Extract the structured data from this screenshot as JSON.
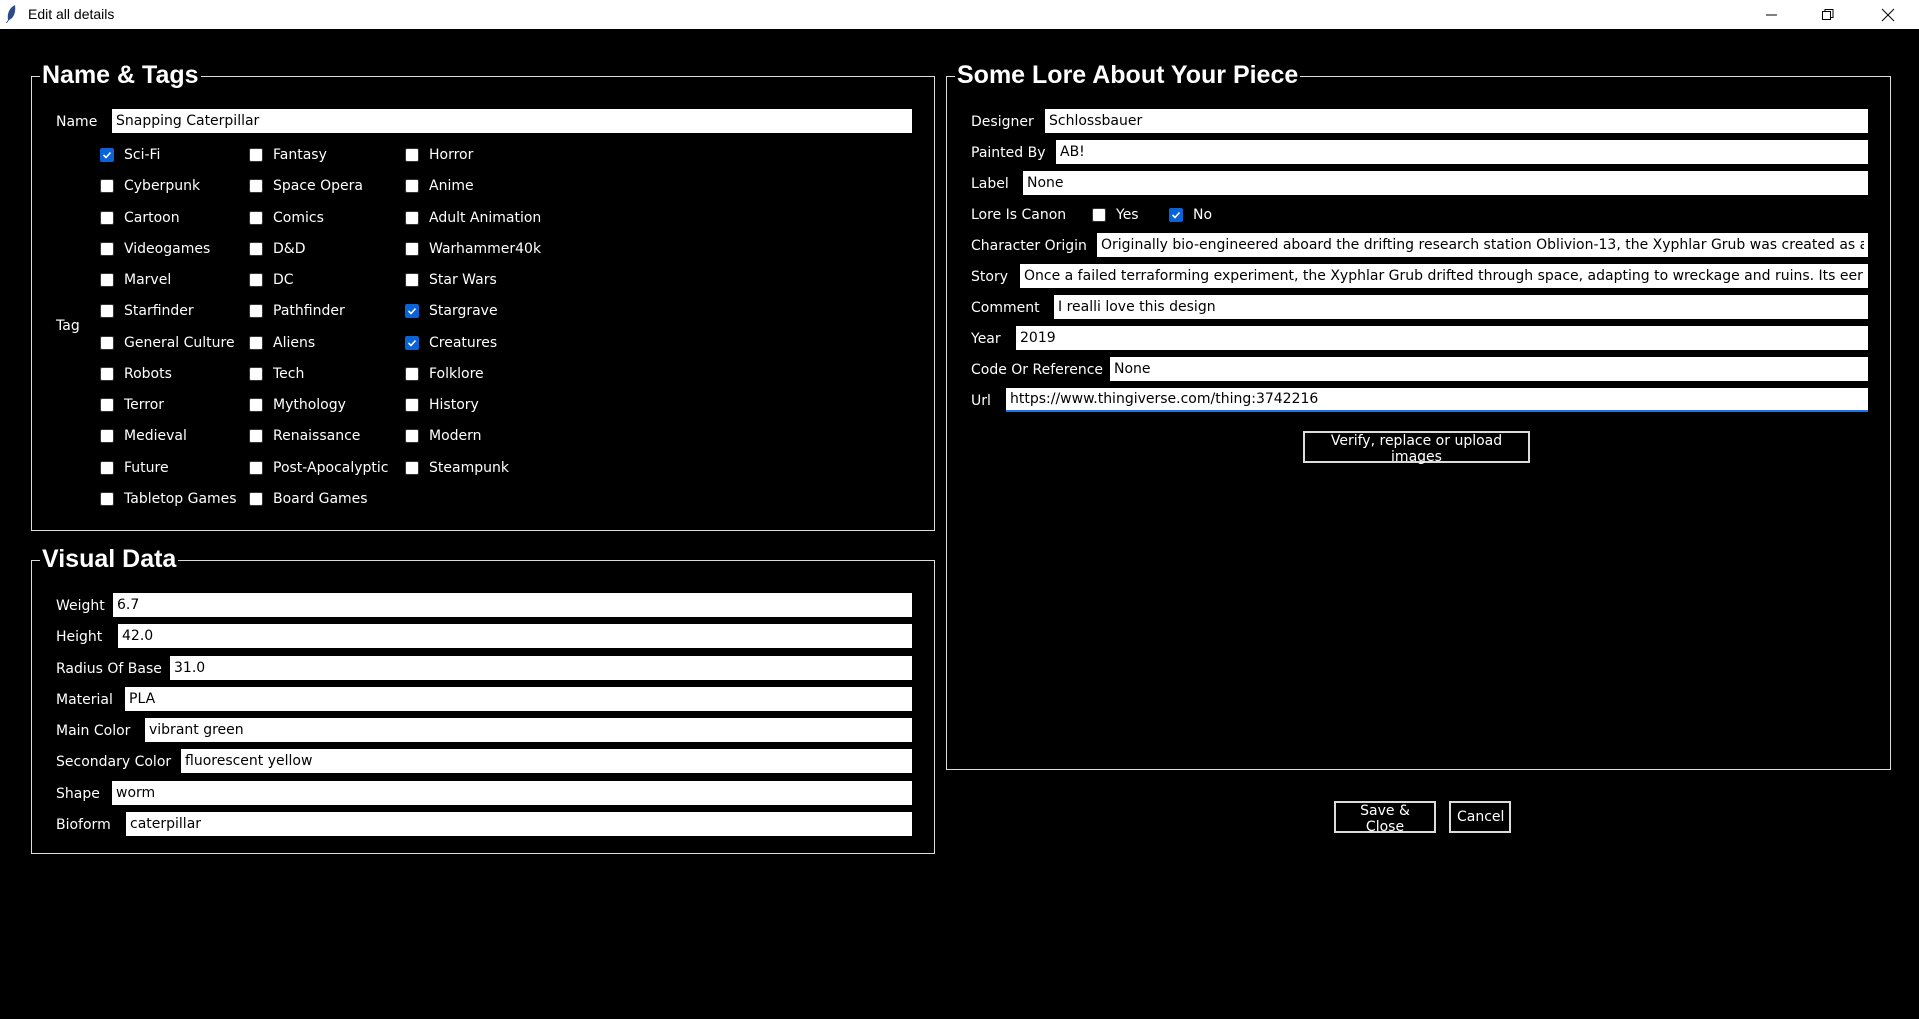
{
  "window": {
    "title": "Edit all details"
  },
  "name_tags": {
    "title": "Name & Tags",
    "name_label": "Name",
    "name_value": "Snapping Caterpillar",
    "tag_label": "Tag",
    "tags": [
      {
        "label": "Sci-Fi",
        "checked": true
      },
      {
        "label": "Fantasy",
        "checked": false
      },
      {
        "label": "Horror",
        "checked": false
      },
      {
        "label": "Cyberpunk",
        "checked": false
      },
      {
        "label": "Space Opera",
        "checked": false
      },
      {
        "label": "Anime",
        "checked": false
      },
      {
        "label": "Cartoon",
        "checked": false
      },
      {
        "label": "Comics",
        "checked": false
      },
      {
        "label": "Adult Animation",
        "checked": false
      },
      {
        "label": "Videogames",
        "checked": false
      },
      {
        "label": "D&D",
        "checked": false
      },
      {
        "label": "Warhammer40k",
        "checked": false
      },
      {
        "label": "Marvel",
        "checked": false
      },
      {
        "label": "DC",
        "checked": false
      },
      {
        "label": "Star Wars",
        "checked": false
      },
      {
        "label": "Starfinder",
        "checked": false
      },
      {
        "label": "Pathfinder",
        "checked": false
      },
      {
        "label": "Stargrave",
        "checked": true
      },
      {
        "label": "General Culture",
        "checked": false
      },
      {
        "label": "Aliens",
        "checked": false
      },
      {
        "label": "Creatures",
        "checked": true
      },
      {
        "label": "Robots",
        "checked": false
      },
      {
        "label": "Tech",
        "checked": false
      },
      {
        "label": "Folklore",
        "checked": false
      },
      {
        "label": "Terror",
        "checked": false
      },
      {
        "label": "Mythology",
        "checked": false
      },
      {
        "label": "History",
        "checked": false
      },
      {
        "label": "Medieval",
        "checked": false
      },
      {
        "label": "Renaissance",
        "checked": false
      },
      {
        "label": "Modern",
        "checked": false
      },
      {
        "label": "Future",
        "checked": false
      },
      {
        "label": "Post-Apocalyptic",
        "checked": false
      },
      {
        "label": "Steampunk",
        "checked": false
      },
      {
        "label": "Tabletop Games",
        "checked": false
      },
      {
        "label": "Board Games",
        "checked": false
      }
    ]
  },
  "visual": {
    "title": "Visual Data",
    "fields": [
      {
        "label": "Weight",
        "value": "6.7"
      },
      {
        "label": "Height",
        "value": "42.0"
      },
      {
        "label": "Radius Of Base",
        "value": "31.0"
      },
      {
        "label": "Material",
        "value": "PLA"
      },
      {
        "label": "Main Color",
        "value": "vibrant green"
      },
      {
        "label": "Secondary Color",
        "value": "fluorescent yellow"
      },
      {
        "label": "Shape",
        "value": "worm"
      },
      {
        "label": "Bioform",
        "value": "caterpillar"
      }
    ]
  },
  "lore": {
    "title": "Some Lore About Your Piece",
    "designer": {
      "label": "Designer",
      "value": "Schlossbauer"
    },
    "painted_by": {
      "label": "Painted By",
      "value": "AB!"
    },
    "label_field": {
      "label": "Label",
      "value": "None"
    },
    "canon": {
      "label": "Lore Is Canon",
      "yes": "Yes",
      "no": "No",
      "yes_checked": false,
      "no_checked": true
    },
    "character_origin": {
      "label": "Character Origin",
      "value": "Originally bio-engineered aboard the drifting research station Oblivion-13, the Xyphlar Grub was created as an experi"
    },
    "story": {
      "label": "Story",
      "value": "Once a failed terraforming experiment, the Xyphlar Grub drifted through space, adapting to wreckage and ruins. Its eerie glow m"
    },
    "comment": {
      "label": "Comment",
      "value": "I realli love this design"
    },
    "year": {
      "label": "Year",
      "value": "2019"
    },
    "code": {
      "label": "Code Or Reference",
      "value": "None"
    },
    "url": {
      "label": "Url",
      "value": "https://www.thingiverse.com/thing:3742216"
    },
    "images_button": "Verify, replace or upload images"
  },
  "actions": {
    "save": "Save & Close",
    "cancel": "Cancel"
  },
  "colors": {
    "background": "#000000",
    "accent": "#0a64d8",
    "titlebar": "#ffffff"
  }
}
